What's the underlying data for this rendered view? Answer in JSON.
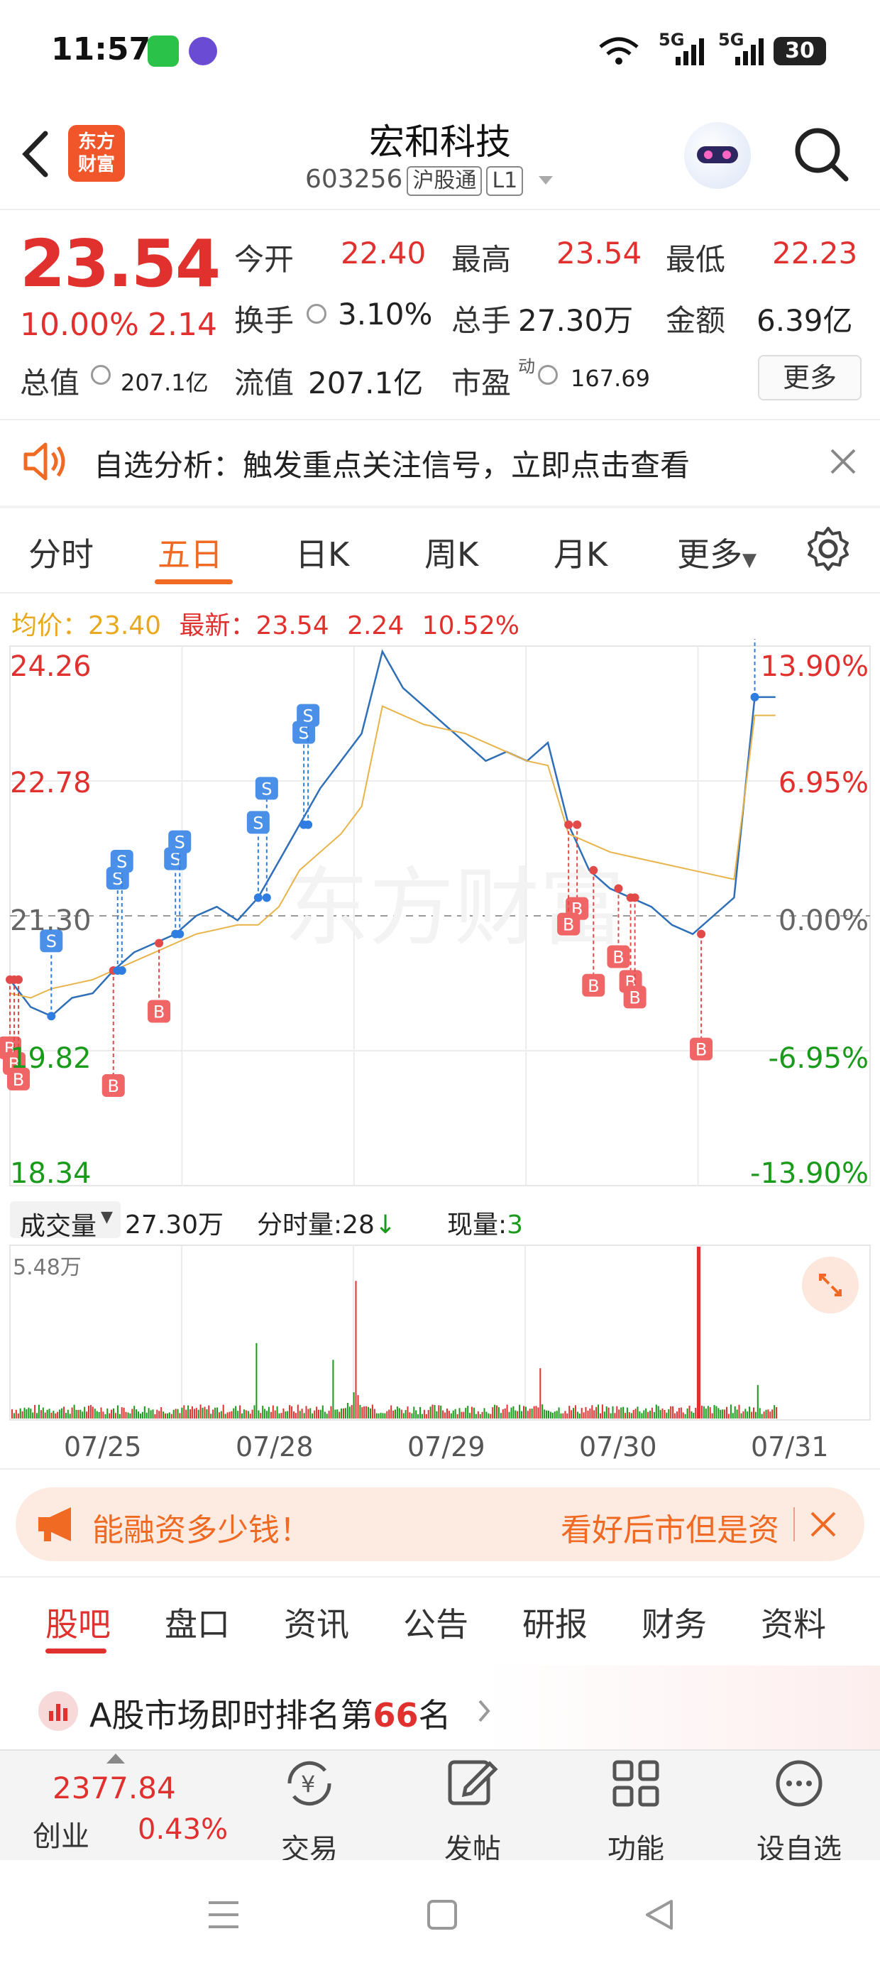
{
  "status_bar": {
    "time": "11:57",
    "battery": "30",
    "signal1": "5G",
    "signal2": "5G"
  },
  "header": {
    "title": "宏和科技",
    "code": "603256",
    "tag1": "沪股通",
    "tag2": "L1",
    "logo_text": "东方\n财富"
  },
  "quote": {
    "price": "23.54",
    "change_pct": "10.00%",
    "change": "2.14",
    "open_label": "今开",
    "open": "22.40",
    "high_label": "最高",
    "high": "23.54",
    "low_label": "最低",
    "low": "22.23",
    "turnover_label": "换手",
    "turnover": "3.10%",
    "volume_label": "总手",
    "volume": "27.30万",
    "amount_label": "金额",
    "amount": "6.39亿",
    "mktcap_label": "总值",
    "mktcap": "207.1亿",
    "float_label": "流值",
    "float": "207.1亿",
    "pe_label": "市盈",
    "pe_sup": "动",
    "pe": "167.69",
    "more_btn": "更多"
  },
  "notice": {
    "text": "自选分析：触发重点关注信号，立即点击查看"
  },
  "chart_tabs": [
    "分时",
    "五日",
    "日K",
    "周K",
    "月K",
    "更多"
  ],
  "chart_tabs_active": 1,
  "legend": {
    "avg_label": "均价：",
    "avg": "23.40",
    "latest_label": "最新：",
    "latest": "23.54",
    "chg": "2.24",
    "chg_pct": "10.52%"
  },
  "chart_data": {
    "type": "line",
    "y_left_ticks": [
      "24.26",
      "22.78",
      "21.30",
      "19.82",
      "18.34"
    ],
    "y_right_ticks": [
      "13.90%",
      "6.95%",
      "0.00%",
      "-6.95%",
      "-13.90%"
    ],
    "ylim": [
      18.34,
      24.26
    ],
    "x_ticks": [
      "07/25",
      "07/28",
      "07/29",
      "07/30",
      "07/31"
    ],
    "series": [
      {
        "values": [
          20.6,
          20.3,
          20.2,
          20.4,
          20.45,
          20.7,
          20.9,
          21.0,
          21.1,
          21.3,
          21.4,
          21.25,
          21.5,
          21.9,
          22.3,
          22.7,
          23.0,
          23.3,
          24.2,
          23.8,
          23.6,
          23.4,
          23.2,
          23.0,
          23.1,
          23.0,
          23.2,
          22.3,
          21.8,
          21.6,
          21.5,
          21.4,
          21.2,
          21.1,
          21.3,
          21.5,
          23.7,
          23.7
        ]
      },
      {
        "values": [
          20.45,
          20.4,
          20.5,
          20.55,
          20.6,
          20.7,
          20.8,
          20.9,
          21.0,
          21.1,
          21.15,
          21.2,
          21.2,
          21.4,
          21.8,
          22.0,
          22.2,
          22.5,
          23.6,
          23.5,
          23.4,
          23.35,
          23.3,
          23.2,
          23.1,
          23.0,
          22.95,
          22.2,
          22.1,
          22.0,
          21.95,
          21.9,
          21.85,
          21.8,
          21.75,
          21.7,
          23.5,
          23.5
        ]
      }
    ],
    "buy_signals": 16,
    "sell_signals": 10
  },
  "volume": {
    "label": "成交量",
    "total": "27.30万",
    "tick_label": "分时量:",
    "tick_val": "28",
    "now_label": "现量:",
    "now_val": "3",
    "max": "5.48万"
  },
  "banner": {
    "left_text": "能融资多少钱！",
    "right_text": "看好后市但是资"
  },
  "sub_tabs": [
    "股吧",
    "盘口",
    "资讯",
    "公告",
    "研报",
    "财务",
    "资料"
  ],
  "rank": {
    "prefix": "A股市场即时排名第",
    "num": "66",
    "suffix": "名"
  },
  "bottom_nav": {
    "index_value": "2377.84",
    "index_name": "创业",
    "index_pct": "0.43%",
    "trade": "交易",
    "post": "发帖",
    "func": "功能",
    "watch": "设自选"
  }
}
